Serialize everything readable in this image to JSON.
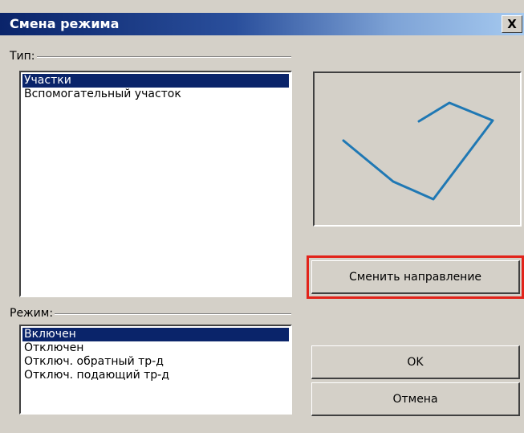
{
  "dialog": {
    "title": "Смена режима",
    "close_symbol": "X"
  },
  "type_group": {
    "label": "Тип:",
    "items": [
      "Участки",
      "Вспомогательный участок"
    ],
    "selected_index": 0
  },
  "mode_group": {
    "label": "Режим:",
    "items": [
      "Включен",
      "Отключен",
      "Отключ. обратный тр-д",
      "Отключ. подающий тр-д"
    ],
    "selected_index": 0
  },
  "buttons": {
    "change_direction": "Сменить направление",
    "ok": "OK",
    "cancel": "Отмена"
  },
  "colors": {
    "title_bar": "#0a246a",
    "selection": "#0a246a",
    "preview_line": "#1f78b4",
    "highlight": "#e2231a",
    "face": "#d4d0c8"
  },
  "icons": [
    "close-icon"
  ]
}
